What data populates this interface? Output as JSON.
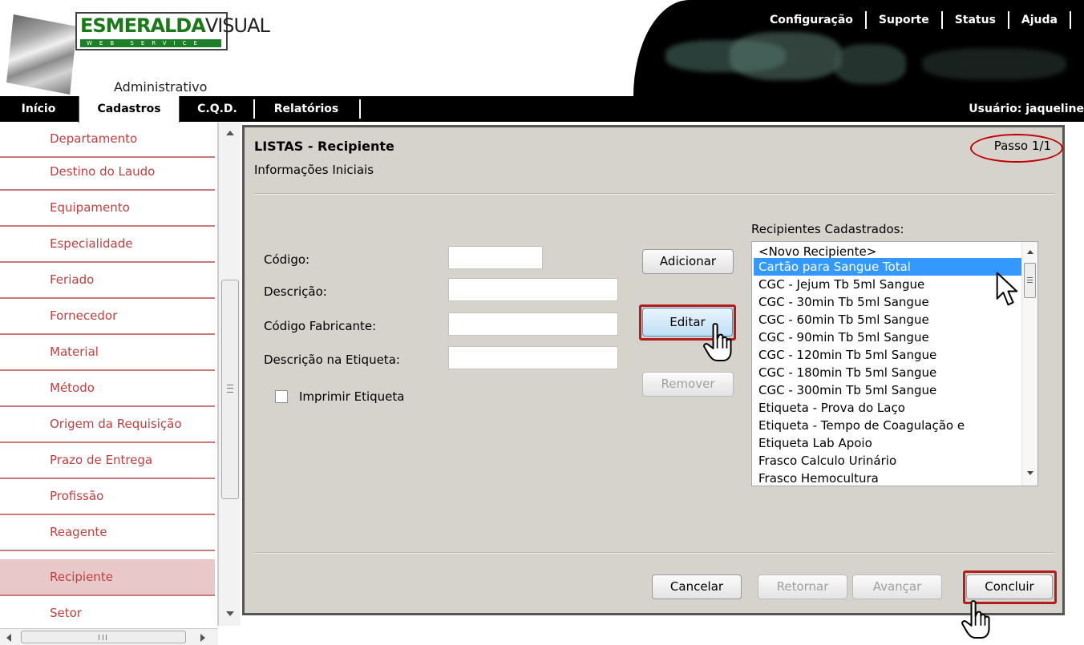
{
  "header": {
    "logo": {
      "brand_green": "ESMERALDA",
      "brand_dark": "VISUAL",
      "tagline": "WEB SERVICE",
      "subtitle": "Administrativo"
    },
    "top_links": [
      "Configuração",
      "Suporte",
      "Status",
      "Ajuda"
    ],
    "menu": {
      "inicio": "Início",
      "cadastros": "Cadastros",
      "cqd": "C.Q.D.",
      "relatorios": "Relatórios"
    },
    "user": "Usuário: jaqueline"
  },
  "sidebar": {
    "items": [
      "Departamento",
      "Destino do Laudo",
      "Equipamento",
      "Especialidade",
      "Feriado",
      "Fornecedor",
      "Material",
      "Método",
      "Origem da Requisição",
      "Prazo de Entrega",
      "Profissão",
      "Reagente",
      "Recipiente",
      "Setor"
    ],
    "active": "Recipiente"
  },
  "dialog": {
    "title": "LISTAS - Recipiente",
    "subtitle": "Informações Iniciais",
    "step": "Passo 1/1",
    "form": {
      "codigo": {
        "label": "Código:",
        "value": ""
      },
      "descricao": {
        "label": "Descrição:",
        "value": ""
      },
      "codigo_fabricante": {
        "label": "Código Fabricante:",
        "value": ""
      },
      "descricao_etiqueta": {
        "label": "Descrição na Etiqueta:",
        "value": ""
      },
      "imprimir_etiqueta": {
        "label": "Imprimir Etiqueta",
        "checked": false
      }
    },
    "actions": {
      "adicionar": "Adicionar",
      "editar": "Editar",
      "remover": "Remover"
    },
    "list": {
      "label": "Recipientes Cadastrados:",
      "selected": "Cartão para Sangue Total",
      "items": [
        "<Novo Recipiente>",
        "Cartão para Sangue Total",
        "CGC -   Jejum Tb 5ml Sangue",
        "CGC -  30min  Tb 5ml Sangue",
        "CGC -  60min  Tb 5ml Sangue",
        "CGC -  90min  Tb 5ml Sangue",
        "CGC - 120min  Tb 5ml Sangue",
        "CGC - 180min  Tb 5ml Sangue",
        "CGC - 300min  Tb 5ml Sangue",
        "Etiqueta - Prova do Laço",
        "Etiqueta - Tempo de Coagulação e",
        "Etiqueta Lab Apoio",
        "Frasco Calculo Urinário",
        "Frasco Hemocultura"
      ]
    },
    "footer": {
      "cancelar": "Cancelar",
      "retornar": "Retornar",
      "avancar": "Avançar",
      "concluir": "Concluir"
    }
  },
  "colors": {
    "sidebar_text": "#c04040",
    "highlight": "#b71c1c",
    "dialog_bg": "#d6d3cc",
    "selection": "#3399ff"
  }
}
